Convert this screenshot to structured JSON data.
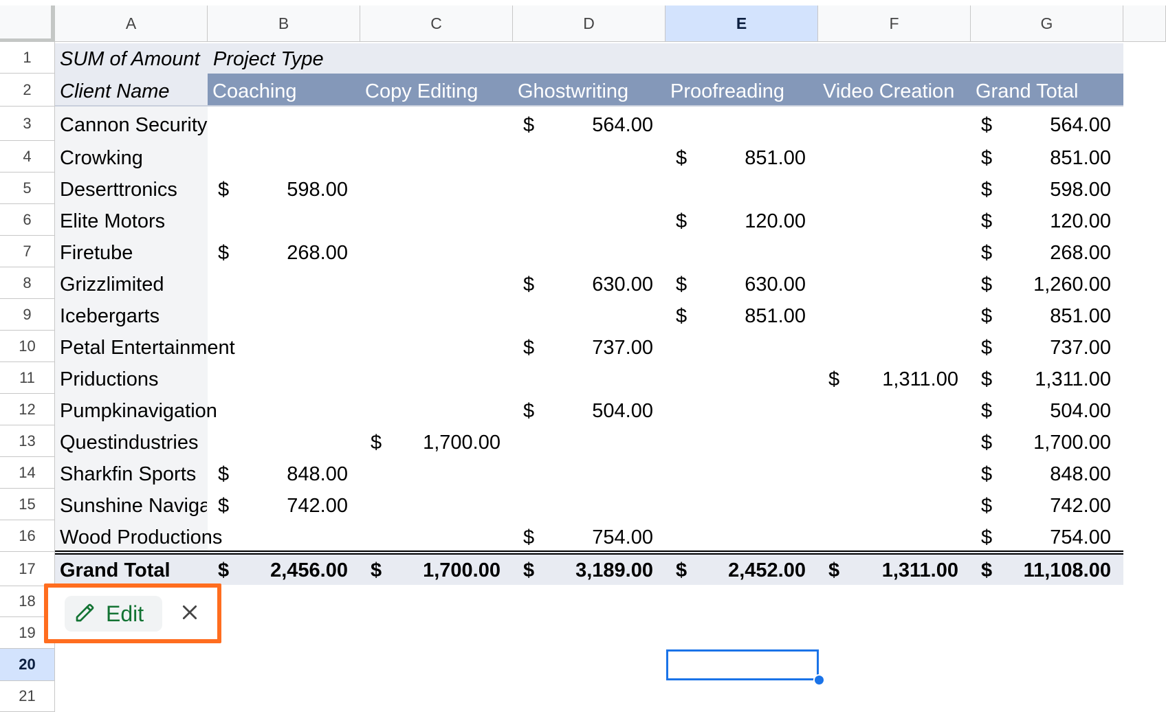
{
  "columns": [
    "A",
    "B",
    "C",
    "D",
    "E",
    "F",
    "G"
  ],
  "rows": [
    "1",
    "2",
    "3",
    "4",
    "5",
    "6",
    "7",
    "8",
    "9",
    "10",
    "11",
    "12",
    "13",
    "14",
    "15",
    "16",
    "17",
    "18",
    "19",
    "20",
    "21"
  ],
  "pivot": {
    "title_sum": "SUM of  Amount",
    "title_project_type": "Project Type",
    "row_label": "Client Name",
    "project_types": [
      "Coaching",
      "Copy Editing",
      "Ghostwriting",
      "Proofreading",
      "Video Creation",
      "Grand Total"
    ],
    "currency_symbol": "$",
    "clients": [
      {
        "name": "Cannon Security",
        "values": [
          "",
          "",
          "564.00",
          "",
          "",
          "564.00"
        ]
      },
      {
        "name": "Crowking",
        "values": [
          "",
          "",
          "",
          "851.00",
          "",
          "851.00"
        ]
      },
      {
        "name": "Deserttronics",
        "values": [
          "598.00",
          "",
          "",
          "",
          "",
          "598.00"
        ]
      },
      {
        "name": "Elite Motors",
        "values": [
          "",
          "",
          "",
          "120.00",
          "",
          "120.00"
        ]
      },
      {
        "name": "Firetube",
        "values": [
          "268.00",
          "",
          "",
          "",
          "",
          "268.00"
        ]
      },
      {
        "name": "Grizzlimited",
        "values": [
          "",
          "",
          "630.00",
          "630.00",
          "",
          "1,260.00"
        ]
      },
      {
        "name": "Icebergarts",
        "values": [
          "",
          "",
          "",
          "851.00",
          "",
          "851.00"
        ]
      },
      {
        "name": "Petal Entertainment",
        "values": [
          "",
          "",
          "737.00",
          "",
          "",
          "737.00"
        ]
      },
      {
        "name": "Priductions",
        "values": [
          "",
          "",
          "",
          "",
          "1,311.00",
          "1,311.00"
        ]
      },
      {
        "name": "Pumpkinavigation",
        "values": [
          "",
          "",
          "504.00",
          "",
          "",
          "504.00"
        ]
      },
      {
        "name": "Questindustries",
        "values": [
          "",
          "1,700.00",
          "",
          "",
          "",
          "1,700.00"
        ]
      },
      {
        "name": "Sharkfin Sports",
        "values": [
          "848.00",
          "",
          "",
          "",
          "",
          "848.00"
        ]
      },
      {
        "name": "Sunshine Navigation",
        "values": [
          "742.00",
          "",
          "",
          "",
          "",
          "742.00"
        ]
      },
      {
        "name": "Wood Productions",
        "values": [
          "",
          "",
          "754.00",
          "",
          "",
          "754.00"
        ]
      }
    ],
    "grand_total_label": "Grand Total",
    "grand_totals": [
      "2,456.00",
      "1,700.00",
      "3,189.00",
      "2,452.00",
      "1,311.00",
      "11,108.00"
    ]
  },
  "edit_chip": {
    "label": "Edit",
    "icon": "pencil-icon",
    "close_icon": "close-icon"
  },
  "selected_cell": "E20",
  "colors": {
    "header_band": "#8498b9",
    "light_band": "#e8ebf2",
    "accent_orange": "#ff6d1f",
    "selection_blue": "#1a73e8",
    "edit_green": "#137333"
  }
}
